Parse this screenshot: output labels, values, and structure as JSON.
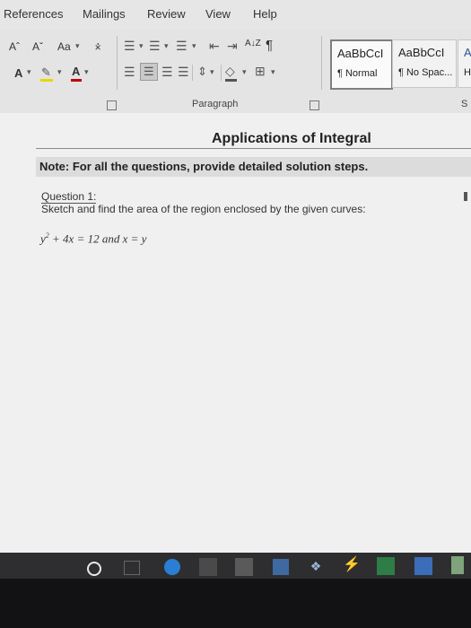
{
  "ribbon": {
    "tabs": [
      "References",
      "Mailings",
      "Review",
      "View",
      "Help"
    ],
    "font_controls": {
      "grow": "Aˆ",
      "shrink": "Aˇ",
      "change_case": "Aa",
      "font_color_letter": "A"
    },
    "paragraph_group_label": "Paragraph",
    "sort_icon": "A↓Z",
    "pilcrow": "¶",
    "styles": [
      {
        "sample": "AaBbCcI",
        "name": "¶ Normal",
        "active": true
      },
      {
        "sample": "AaBbCcI",
        "name": "¶ No Spac...",
        "active": false
      },
      {
        "sample": "Ac",
        "name": "He",
        "active": false
      }
    ],
    "right_edge_letter": "S"
  },
  "document": {
    "title": "Applications of Integral",
    "note": "Note: For all the questions, provide detailed solution steps.",
    "question_label": "Question 1:",
    "question_text": "Sketch and find the area of the region enclosed by the given curves:",
    "equation": {
      "lhs_base": "y",
      "lhs_exp": "2",
      "rest": " + 4x = 12 and x = y"
    }
  },
  "taskbar": {
    "icons": [
      "cortana-circle-icon",
      "task-view-icon",
      "edge-icon",
      "store-icon",
      "file-explorer-icon",
      "mail-icon",
      "dropbox-icon",
      "lightning-icon",
      "excel-icon",
      "word-icon",
      "more-icon"
    ]
  },
  "colors": {
    "taskbar": "#2e2e31",
    "document": "#f0f0f0",
    "ribbon": "#e4e4e4"
  }
}
